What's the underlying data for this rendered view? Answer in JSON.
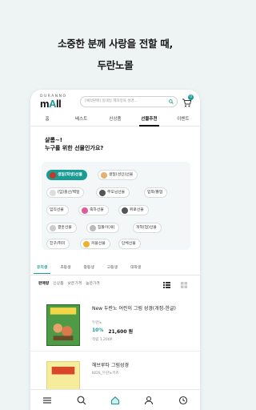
{
  "headline": {
    "line1": "소중한 분께 사랑을 전할 때,",
    "line2": "두란노몰"
  },
  "header": {
    "logo_small": "DURANNO",
    "logo_big_prefix": "m",
    "logo_big_accent": "A",
    "logo_big_suffix": "ll",
    "search_placeholder": "[예약판매] 일대일 제자양육 성경...",
    "cart_count": "0"
  },
  "nav": {
    "tabs": [
      "홈",
      "베스트",
      "신상품",
      "선물추천",
      "이벤트"
    ],
    "active_index": 3
  },
  "gift": {
    "title_line1": "샬롬~!",
    "title_line2": "누구를 위한 선물인가요?",
    "chips": [
      {
        "label": "생일(학생)선물",
        "active": true,
        "icon_color": "#c0392b"
      },
      {
        "label": "생일(성인)선물",
        "active": false,
        "icon_color": "#e8b070"
      },
      {
        "label": "(임)출산/백일",
        "active": false,
        "icon_color": "#999999"
      },
      {
        "label": "부모님선물",
        "active": false,
        "icon_color": "#555555"
      },
      {
        "label": "입학/졸업",
        "active": false,
        "icon_color": ""
      },
      {
        "label": "임직선물",
        "active": false,
        "icon_color": ""
      },
      {
        "label": "축하선물",
        "active": false,
        "icon_color": "#e05a9a"
      },
      {
        "label": "위로선물",
        "active": false,
        "icon_color": "#555555"
      },
      {
        "label": "결혼선물",
        "active": false,
        "icon_color": "#aaaaaa"
      },
      {
        "label": "집들이(새)",
        "active": false,
        "icon_color": "#aaaaaa"
      },
      {
        "label": "개척(업)선물",
        "active": false,
        "icon_color": ""
      },
      {
        "label": "친구/취미",
        "active": false,
        "icon_color": ""
      },
      {
        "label": "커플선물",
        "active": false,
        "icon_color": "#f0b030"
      },
      {
        "label": "단체선물",
        "active": false,
        "icon_color": ""
      }
    ]
  },
  "age_tabs": {
    "items": [
      "유치생",
      "초등생",
      "중등생",
      "고등생",
      "대학생"
    ],
    "active_index": 0
  },
  "sort": {
    "items": [
      "판매량",
      "신상품",
      "낮은가격",
      "높은가격"
    ],
    "active_index": 0
  },
  "books": [
    {
      "title": "New 두란노 어린이 그림 성경(개정-한글)",
      "author": "두란노",
      "discount": "10%",
      "price": "21,600 원",
      "points": "적립 1,200P"
    },
    {
      "title": "헤브루타 그림성경",
      "author": "KIDS_두란노키즈",
      "discount": "",
      "price": "",
      "points": ""
    }
  ],
  "colors": {
    "accent": "#1a9b94",
    "background": "#eef4f4"
  },
  "bottom_nav": {
    "icons": [
      "menu-icon",
      "search-icon",
      "home-icon",
      "user-icon",
      "history-icon"
    ]
  }
}
